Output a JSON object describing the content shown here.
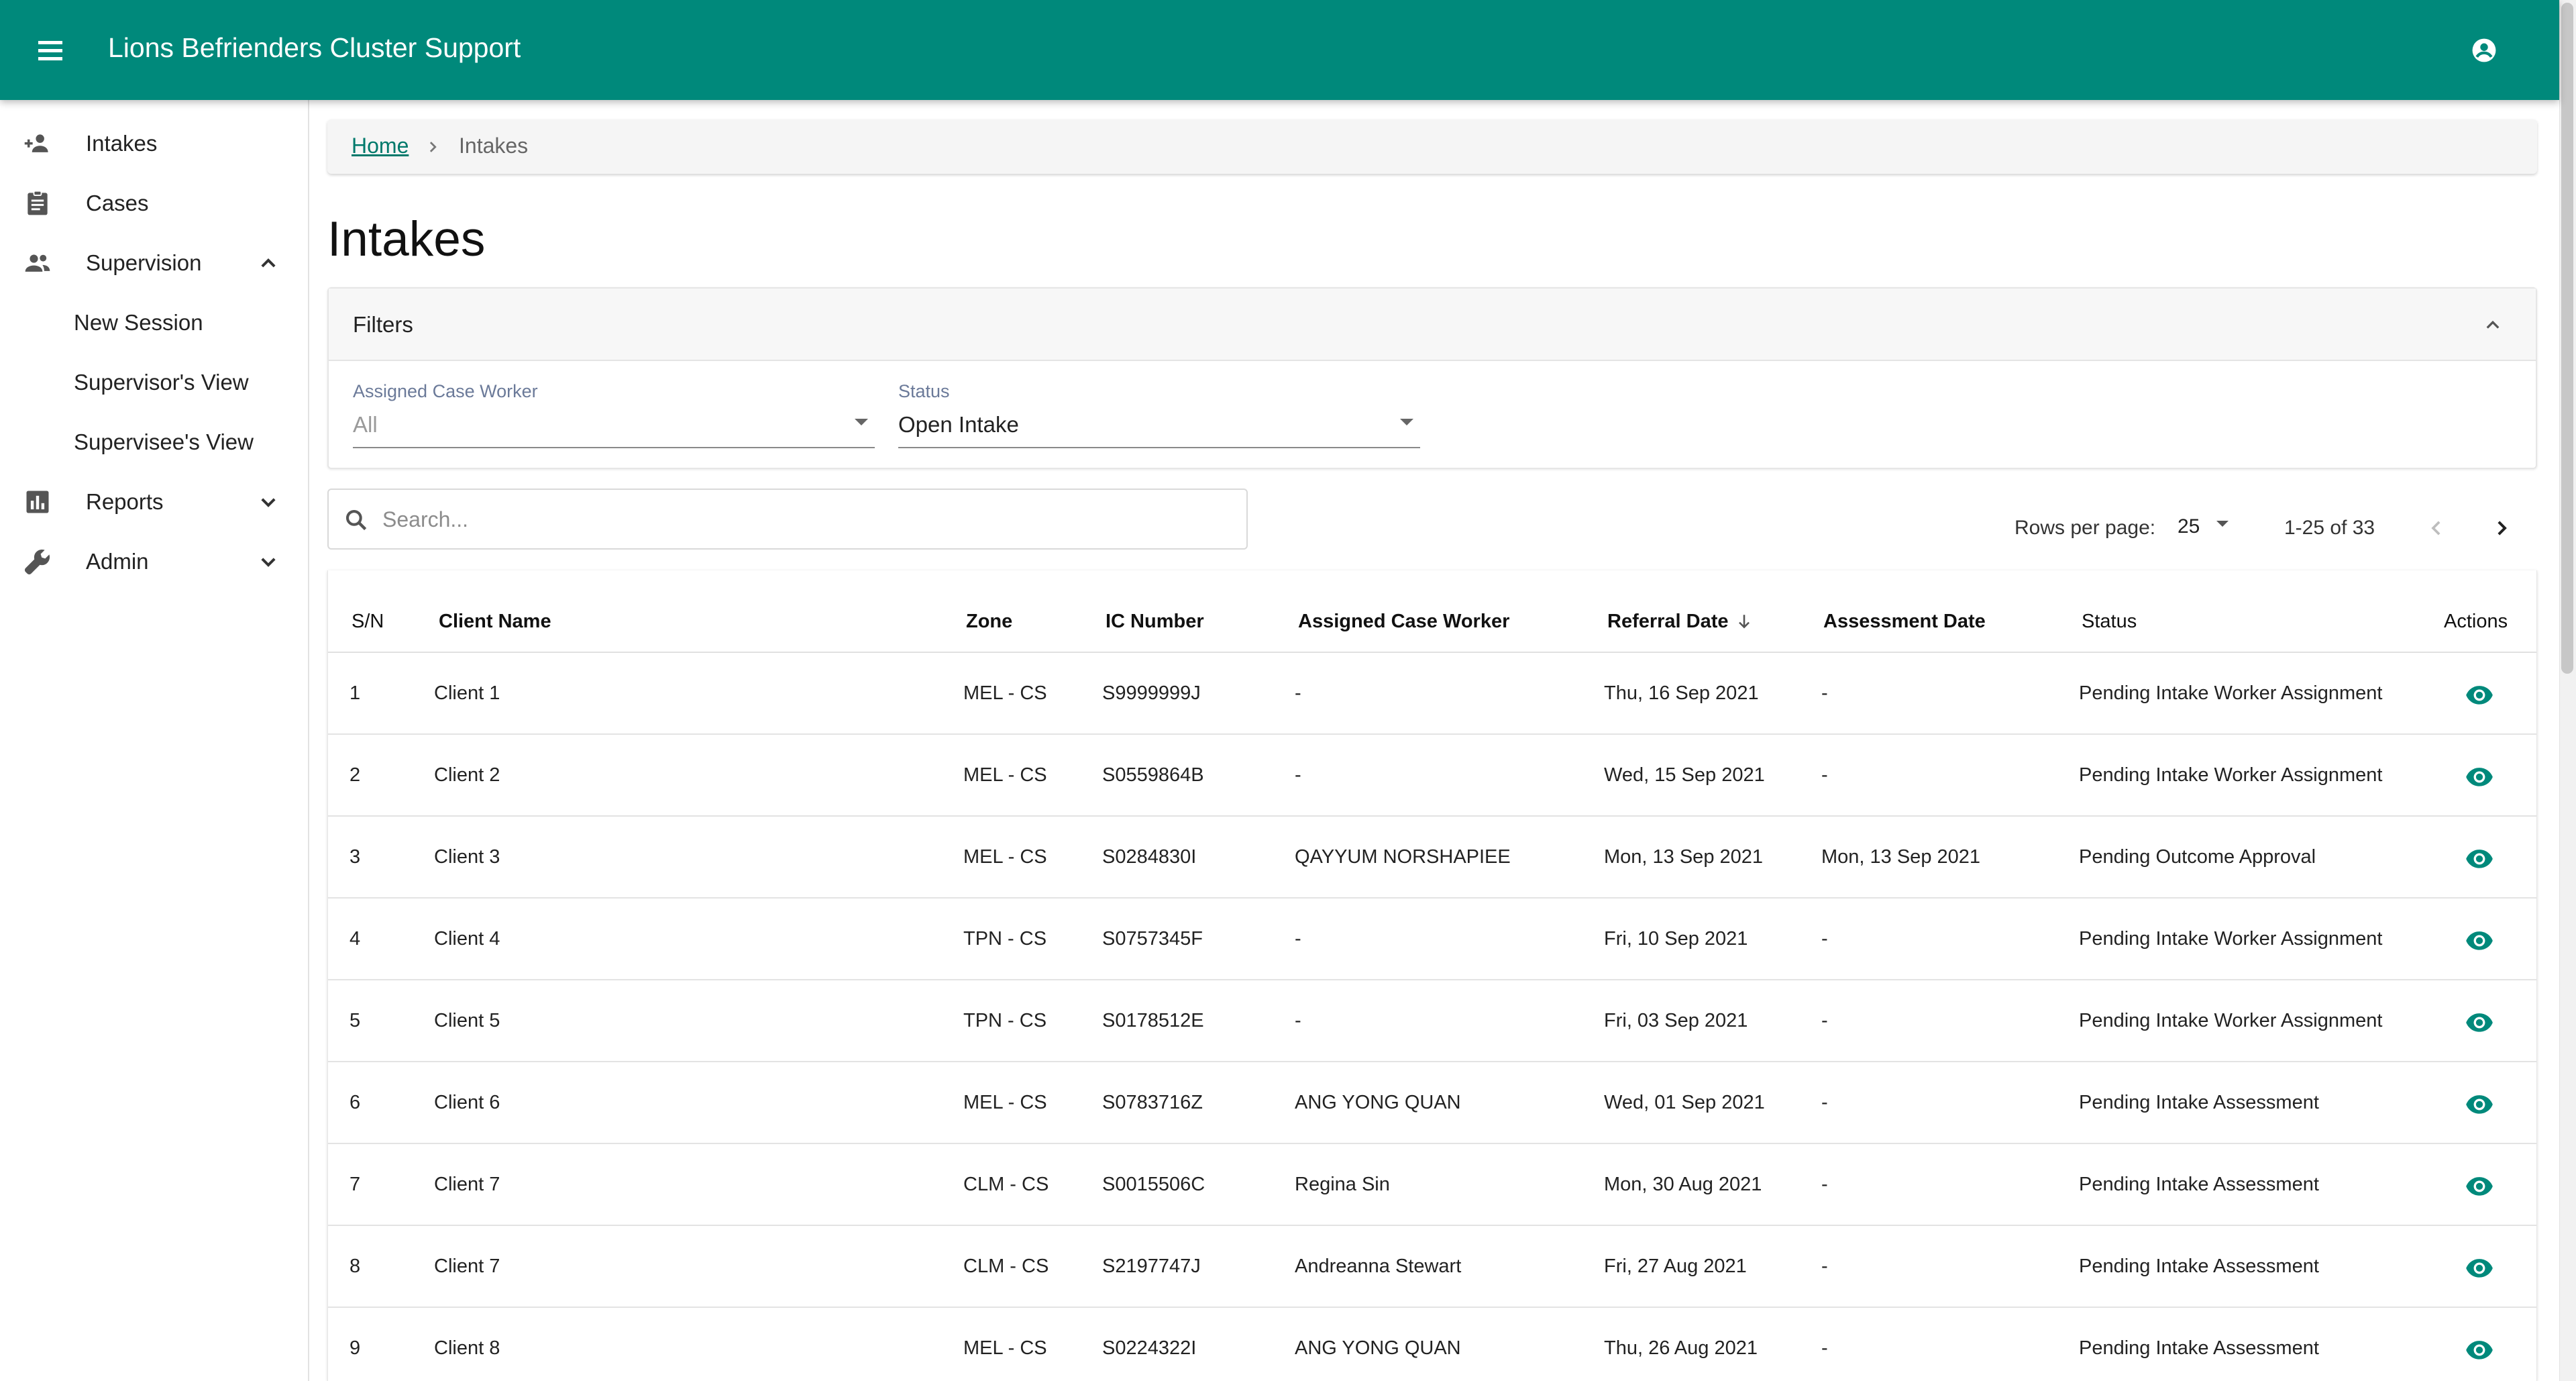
{
  "app": {
    "title": "Lions Befrienders Cluster Support",
    "brand_color": "#00897b",
    "icons": {
      "menu": "menu-icon",
      "account": "account-circle-icon"
    }
  },
  "sidebar": {
    "items": [
      {
        "label": "Intakes",
        "icon": "person-add-icon"
      },
      {
        "label": "Cases",
        "icon": "assignment-icon"
      },
      {
        "label": "Supervision",
        "icon": "people-icon",
        "expanded": true,
        "children": [
          "New Session",
          "Supervisor's View",
          "Supervisee's View"
        ]
      },
      {
        "label": "Reports",
        "icon": "bar-chart-icon",
        "expanded": false
      },
      {
        "label": "Admin",
        "icon": "wrench-icon",
        "expanded": false
      }
    ]
  },
  "breadcrumb": {
    "home": "Home",
    "current": "Intakes"
  },
  "page": {
    "title": "Intakes"
  },
  "filters": {
    "title": "Filters",
    "assigned_case_worker": {
      "label": "Assigned Case Worker",
      "value": "All"
    },
    "status": {
      "label": "Status",
      "value": "Open Intake"
    }
  },
  "search": {
    "placeholder": "Search...",
    "value": ""
  },
  "pagination": {
    "rows_label": "Rows per page:",
    "rows_value": "25",
    "range": "1-25 of 33"
  },
  "table": {
    "headers": {
      "sn": "S/N",
      "client": "Client Name",
      "zone": "Zone",
      "ic": "IC Number",
      "worker": "Assigned Case Worker",
      "referral": "Referral Date",
      "assessment": "Assessment Date",
      "status": "Status",
      "actions": "Actions"
    },
    "sorted_by": "Referral Date",
    "sort_direction": "descending",
    "rows": [
      {
        "sn": "1",
        "client": "Client 1",
        "zone": "MEL - CS",
        "ic": "S9999999J",
        "worker": "-",
        "referral": "Thu, 16 Sep 2021",
        "assessment": "-",
        "status": "Pending Intake Worker Assignment"
      },
      {
        "sn": "2",
        "client": "Client 2",
        "zone": "MEL - CS",
        "ic": "S0559864B",
        "worker": "-",
        "referral": "Wed, 15 Sep 2021",
        "assessment": "-",
        "status": "Pending Intake Worker Assignment"
      },
      {
        "sn": "3",
        "client": "Client 3",
        "zone": "MEL - CS",
        "ic": "S0284830I",
        "worker": "QAYYUM NORSHAPIEE",
        "referral": "Mon, 13 Sep 2021",
        "assessment": "Mon, 13 Sep 2021",
        "status": "Pending Outcome Approval"
      },
      {
        "sn": "4",
        "client": "Client 4",
        "zone": "TPN - CS",
        "ic": "S0757345F",
        "worker": "-",
        "referral": "Fri, 10 Sep 2021",
        "assessment": "-",
        "status": "Pending Intake Worker Assignment"
      },
      {
        "sn": "5",
        "client": "Client 5",
        "zone": "TPN - CS",
        "ic": "S0178512E",
        "worker": "-",
        "referral": "Fri, 03 Sep 2021",
        "assessment": "-",
        "status": "Pending Intake Worker Assignment"
      },
      {
        "sn": "6",
        "client": "Client 6",
        "zone": "MEL - CS",
        "ic": "S0783716Z",
        "worker": "ANG YONG QUAN",
        "referral": "Wed, 01 Sep 2021",
        "assessment": "-",
        "status": "Pending Intake Assessment"
      },
      {
        "sn": "7",
        "client": "Client 7",
        "zone": "CLM - CS",
        "ic": "S0015506C",
        "worker": "Regina Sin",
        "referral": "Mon, 30 Aug 2021",
        "assessment": "-",
        "status": "Pending Intake Assessment"
      },
      {
        "sn": "8",
        "client": "Client 7",
        "zone": "CLM - CS",
        "ic": "S2197747J",
        "worker": "Andreanna Stewart",
        "referral": "Fri, 27 Aug 2021",
        "assessment": "-",
        "status": "Pending Intake Assessment"
      },
      {
        "sn": "9",
        "client": "Client 8",
        "zone": "MEL - CS",
        "ic": "S0224322I",
        "worker": "ANG YONG QUAN",
        "referral": "Thu, 26 Aug 2021",
        "assessment": "-",
        "status": "Pending Intake Assessment"
      }
    ]
  }
}
